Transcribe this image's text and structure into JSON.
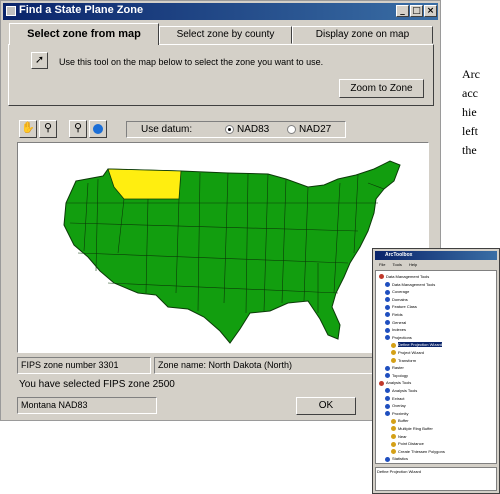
{
  "dialog": {
    "title": "Find a State Plane Zone",
    "tabs": [
      {
        "label": "Select zone from map",
        "active": true
      },
      {
        "label": "Select zone by county",
        "active": false
      },
      {
        "label": "Display zone on map",
        "active": false
      }
    ],
    "tool_instruction": "Use this tool on the map below to select the zone you want to use.",
    "zoom_button": "Zoom to Zone",
    "datum": {
      "label": "Use datum:",
      "options": [
        "NAD83",
        "NAD27"
      ],
      "selected": "NAD83"
    },
    "fips_zone": "FIPS zone number 3301",
    "zone_name": "Zone name: North Dakota (North)",
    "selected_message": "You have selected FIPS zone 2500",
    "result_value": "Montana NAD83",
    "ok_button": "OK",
    "colors": {
      "map_fill": "#129e0f",
      "highlight": "#ffee10",
      "titlebar": "#0a246a"
    }
  },
  "side_text": [
    "Arc",
    "acc",
    "hie",
    "left",
    "the"
  ],
  "toolbox": {
    "title": "ArcToolbox",
    "menu": [
      "File",
      "Tools",
      "Help"
    ],
    "items": [
      {
        "label": "Data Management Tools",
        "level": 0
      },
      {
        "label": "Data Management Tools",
        "level": 1
      },
      {
        "label": "Coverage",
        "level": 1
      },
      {
        "label": "Domains",
        "level": 1
      },
      {
        "label": "Feature Class",
        "level": 1
      },
      {
        "label": "Fields",
        "level": 1
      },
      {
        "label": "General",
        "level": 1
      },
      {
        "label": "Indexes",
        "level": 1
      },
      {
        "label": "Projections",
        "level": 1
      },
      {
        "label": "Define Projection Wizard",
        "level": 2
      },
      {
        "label": "Project Wizard",
        "level": 2
      },
      {
        "label": "Transform",
        "level": 2
      },
      {
        "label": "Raster",
        "level": 1
      },
      {
        "label": "Topology",
        "level": 1
      },
      {
        "label": "Analysis Tools",
        "level": 0
      },
      {
        "label": "Analysis Tools",
        "level": 1
      },
      {
        "label": "Extract",
        "level": 1
      },
      {
        "label": "Overlay",
        "level": 1
      },
      {
        "label": "Proximity",
        "level": 1
      },
      {
        "label": "Buffer",
        "level": 2
      },
      {
        "label": "Multiple Ring Buffer",
        "level": 2
      },
      {
        "label": "Near",
        "level": 2
      },
      {
        "label": "Point Distance",
        "level": 2
      },
      {
        "label": "Create Thiessen Polygons",
        "level": 2
      },
      {
        "label": "Statistics",
        "level": 1
      }
    ],
    "selected_index": 9,
    "status": "Define Projection Wizard"
  }
}
